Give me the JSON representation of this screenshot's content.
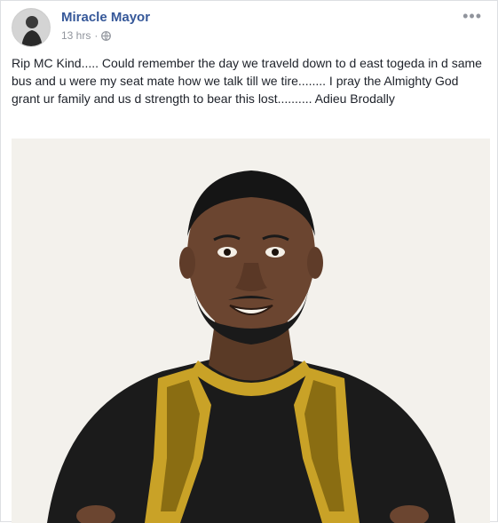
{
  "post": {
    "author_name": "Miracle Mayor",
    "timestamp": "13 hrs",
    "separator": "·",
    "privacy_icon": "globe-icon",
    "menu_icon": "more-options-icon",
    "menu_glyph": "•••",
    "text": "Rip MC Kind..... Could remember the day we traveld down to d east togeda in d same bus and u were my seat mate how we talk till we tire........ I pray the Almighty God grant ur family and us d strength to bear this lost.......... Adieu Brodally"
  },
  "colors": {
    "author": "#365899",
    "meta": "#90949c",
    "text": "#1d2129",
    "photo_background": "#f3f1ec",
    "garment": "#1b1b1b",
    "embroidery": "#c9a227"
  }
}
